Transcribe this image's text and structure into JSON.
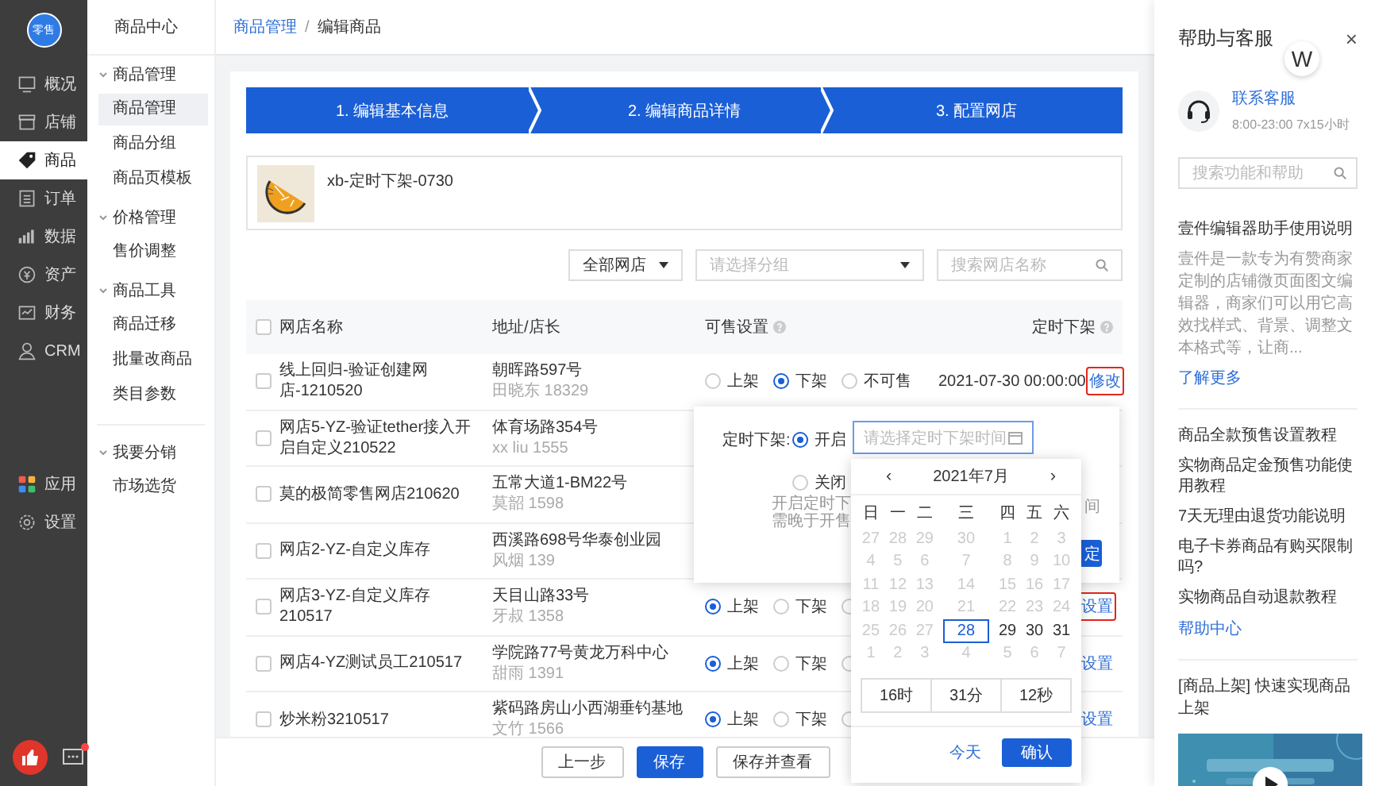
{
  "sidebar": {
    "logo": "零售",
    "items": [
      {
        "label": "概况",
        "selected": false
      },
      {
        "label": "店铺",
        "selected": false
      },
      {
        "label": "商品",
        "selected": true
      },
      {
        "label": "订单",
        "selected": false
      },
      {
        "label": "数据",
        "selected": false
      },
      {
        "label": "资产",
        "selected": false
      },
      {
        "label": "财务",
        "selected": false
      },
      {
        "label": "CRM",
        "selected": false
      }
    ],
    "bottom_items": [
      {
        "label": "应用",
        "selected": false
      },
      {
        "label": "设置",
        "selected": false
      }
    ],
    "chat_unread": true
  },
  "subnav": {
    "title": "商品中心",
    "groups": [
      {
        "label": "商品管理",
        "expanded": true,
        "separated": false,
        "children": [
          {
            "label": "商品管理",
            "selected": true
          },
          {
            "label": "商品分组",
            "selected": false
          },
          {
            "label": "商品页模板",
            "selected": false
          }
        ]
      },
      {
        "label": "价格管理",
        "expanded": true,
        "separated": false,
        "children": [
          {
            "label": "售价调整",
            "selected": false
          }
        ]
      },
      {
        "label": "商品工具",
        "expanded": true,
        "separated": false,
        "children": [
          {
            "label": "商品迁移",
            "selected": false
          },
          {
            "label": "批量改商品",
            "selected": false
          },
          {
            "label": "类目参数",
            "selected": false
          }
        ]
      },
      {
        "label": "我要分销",
        "expanded": true,
        "separated": true,
        "children": [
          {
            "label": "市场选货",
            "selected": false
          }
        ]
      }
    ]
  },
  "breadcrumb": {
    "items": [
      "商品管理",
      "编辑商品"
    ],
    "separator": "/"
  },
  "steps": [
    {
      "label": "1. 编辑基本信息",
      "active": true
    },
    {
      "label": "2. 编辑商品详情",
      "active": true
    },
    {
      "label": "3. 配置网店",
      "active": true
    }
  ],
  "product": {
    "name": "xb-定时下架-0730"
  },
  "filters": {
    "shop_select": {
      "value": "全部网店"
    },
    "group_select": {
      "placeholder": "请选择分组"
    },
    "search": {
      "placeholder": "搜索网店名称"
    }
  },
  "table": {
    "select_all": false,
    "columns": [
      {
        "label": "网店名称",
        "help": false
      },
      {
        "label": "地址/店长",
        "help": false
      },
      {
        "label": "可售设置",
        "help": true
      },
      {
        "label": "定时下架",
        "help": true
      }
    ],
    "rows": [
      {
        "checked": false,
        "name": "线上回归-验证创建网店-1210520",
        "address": "朝晖路597号",
        "manager": "田晓东 18329",
        "options": [
          {
            "label": "上架",
            "selected": false
          },
          {
            "label": "下架",
            "selected": true
          },
          {
            "label": "不可售",
            "selected": false
          }
        ],
        "time": "2021-07-30 00:00:00",
        "action": {
          "label": "修改",
          "highlighted": true
        }
      },
      {
        "checked": false,
        "name": "网店5-YZ-验证tether接入开启自定义210522",
        "address": "体育场路354号",
        "manager": "xx liu 1555"
      },
      {
        "checked": false,
        "name": "莫的极简零售网店210620",
        "address": "五常大道1-BM22号",
        "manager": "莫韶 1598"
      },
      {
        "checked": false,
        "name": "网店2-YZ-自定义库存",
        "address": "西溪路698号华泰创业园",
        "manager": "风烟 139"
      },
      {
        "checked": false,
        "name": "网店3-YZ-自定义库存210517",
        "address": "天目山路33号",
        "manager": "牙叔 1358",
        "options": [
          {
            "label": "上架",
            "selected": true
          },
          {
            "label": "下架",
            "selected": false
          },
          {
            "selected": false
          }
        ],
        "action": {
          "label": "设置",
          "highlighted": true
        }
      },
      {
        "checked": false,
        "name": "网店4-YZ测试员工210517",
        "address": "学院路77号黄龙万科中心",
        "manager": "甜雨 1391",
        "options": [
          {
            "label": "上架",
            "selected": true
          },
          {
            "label": "下架",
            "selected": false
          },
          {
            "selected": false
          }
        ],
        "action": {
          "label": "设置",
          "highlighted": false
        }
      },
      {
        "checked": false,
        "name": "炒米粉3210517",
        "address": "紫码路房山小西湖垂钓基地",
        "manager": "文竹 1566",
        "options": [
          {
            "label": "上架",
            "selected": true
          },
          {
            "label": "下架",
            "selected": false
          },
          {
            "selected": false
          }
        ],
        "action": {
          "label": "设置",
          "highlighted": false
        }
      }
    ]
  },
  "footer": {
    "buttons": [
      {
        "label": "上一步",
        "kind": "default"
      },
      {
        "label": "保存",
        "kind": "primary"
      },
      {
        "label": "保存并查看",
        "kind": "default"
      }
    ]
  },
  "popover": {
    "label": "定时下架:",
    "options": [
      {
        "label": "开启",
        "selected": true
      },
      {
        "label": "关闭",
        "selected": false
      }
    ],
    "date_input": {
      "placeholder": "请选择定时下架时间"
    },
    "hint_lines": [
      "开启定时下",
      "需晚于开售"
    ],
    "hint_tail": "间",
    "confirm": "定"
  },
  "calendar": {
    "month": "2021年7月",
    "prev": "‹",
    "next": "›",
    "weekdays": [
      "日",
      "一",
      "二",
      "三",
      "四",
      "五",
      "六"
    ],
    "weeks": [
      [
        {
          "d": "27",
          "disabled": true,
          "selected": false
        },
        {
          "d": "28",
          "disabled": true,
          "selected": false
        },
        {
          "d": "29",
          "disabled": true,
          "selected": false
        },
        {
          "d": "30",
          "disabled": true,
          "selected": false
        },
        {
          "d": "1",
          "disabled": true,
          "selected": false
        },
        {
          "d": "2",
          "disabled": true,
          "selected": false
        },
        {
          "d": "3",
          "disabled": true,
          "selected": false
        }
      ],
      [
        {
          "d": "4",
          "disabled": true,
          "selected": false
        },
        {
          "d": "5",
          "disabled": true,
          "selected": false
        },
        {
          "d": "6",
          "disabled": true,
          "selected": false
        },
        {
          "d": "7",
          "disabled": true,
          "selected": false
        },
        {
          "d": "8",
          "disabled": true,
          "selected": false
        },
        {
          "d": "9",
          "disabled": true,
          "selected": false
        },
        {
          "d": "10",
          "disabled": true,
          "selected": false
        }
      ],
      [
        {
          "d": "11",
          "disabled": true,
          "selected": false
        },
        {
          "d": "12",
          "disabled": true,
          "selected": false
        },
        {
          "d": "13",
          "disabled": true,
          "selected": false
        },
        {
          "d": "14",
          "disabled": true,
          "selected": false
        },
        {
          "d": "15",
          "disabled": true,
          "selected": false
        },
        {
          "d": "16",
          "disabled": true,
          "selected": false
        },
        {
          "d": "17",
          "disabled": true,
          "selected": false
        }
      ],
      [
        {
          "d": "18",
          "disabled": true,
          "selected": false
        },
        {
          "d": "19",
          "disabled": true,
          "selected": false
        },
        {
          "d": "20",
          "disabled": true,
          "selected": false
        },
        {
          "d": "21",
          "disabled": true,
          "selected": false
        },
        {
          "d": "22",
          "disabled": true,
          "selected": false
        },
        {
          "d": "23",
          "disabled": true,
          "selected": false
        },
        {
          "d": "24",
          "disabled": true,
          "selected": false
        }
      ],
      [
        {
          "d": "25",
          "disabled": true,
          "selected": false
        },
        {
          "d": "26",
          "disabled": true,
          "selected": false
        },
        {
          "d": "27",
          "disabled": true,
          "selected": false
        },
        {
          "d": "28",
          "disabled": false,
          "selected": true
        },
        {
          "d": "29",
          "disabled": false,
          "selected": false
        },
        {
          "d": "30",
          "disabled": false,
          "selected": false
        },
        {
          "d": "31",
          "disabled": false,
          "selected": false
        }
      ],
      [
        {
          "d": "1",
          "disabled": true,
          "selected": false
        },
        {
          "d": "2",
          "disabled": true,
          "selected": false
        },
        {
          "d": "3",
          "disabled": true,
          "selected": false
        },
        {
          "d": "4",
          "disabled": true,
          "selected": false
        },
        {
          "d": "5",
          "disabled": true,
          "selected": false
        },
        {
          "d": "6",
          "disabled": true,
          "selected": false
        },
        {
          "d": "7",
          "disabled": true,
          "selected": false
        }
      ]
    ],
    "time": [
      "16时",
      "31分",
      "12秒"
    ],
    "today": "今天",
    "confirm": "确认"
  },
  "help": {
    "title": "帮助与客服",
    "close": "×",
    "badge": "W",
    "contact": {
      "link": "联系客服",
      "hours": "8:00-23:00  7x15小时"
    },
    "search": {
      "placeholder": "搜索功能和帮助"
    },
    "article": {
      "title": "壹件编辑器助手使用说明",
      "body": "壹件是一款专为有赞商家定制的店铺微页面图文编辑器，商家们可以用它高效找样式、背景、调整文本格式等，让商...",
      "more": "了解更多"
    },
    "links": [
      "商品全款预售设置教程",
      "实物商品定金预售功能使用教程",
      "7天无理由退货功能说明",
      "电子卡券商品有购买限制吗?",
      "实物商品自动退款教程"
    ],
    "center": "帮助中心",
    "video": {
      "title": "[商品上架]  快速实现商品上架"
    }
  }
}
